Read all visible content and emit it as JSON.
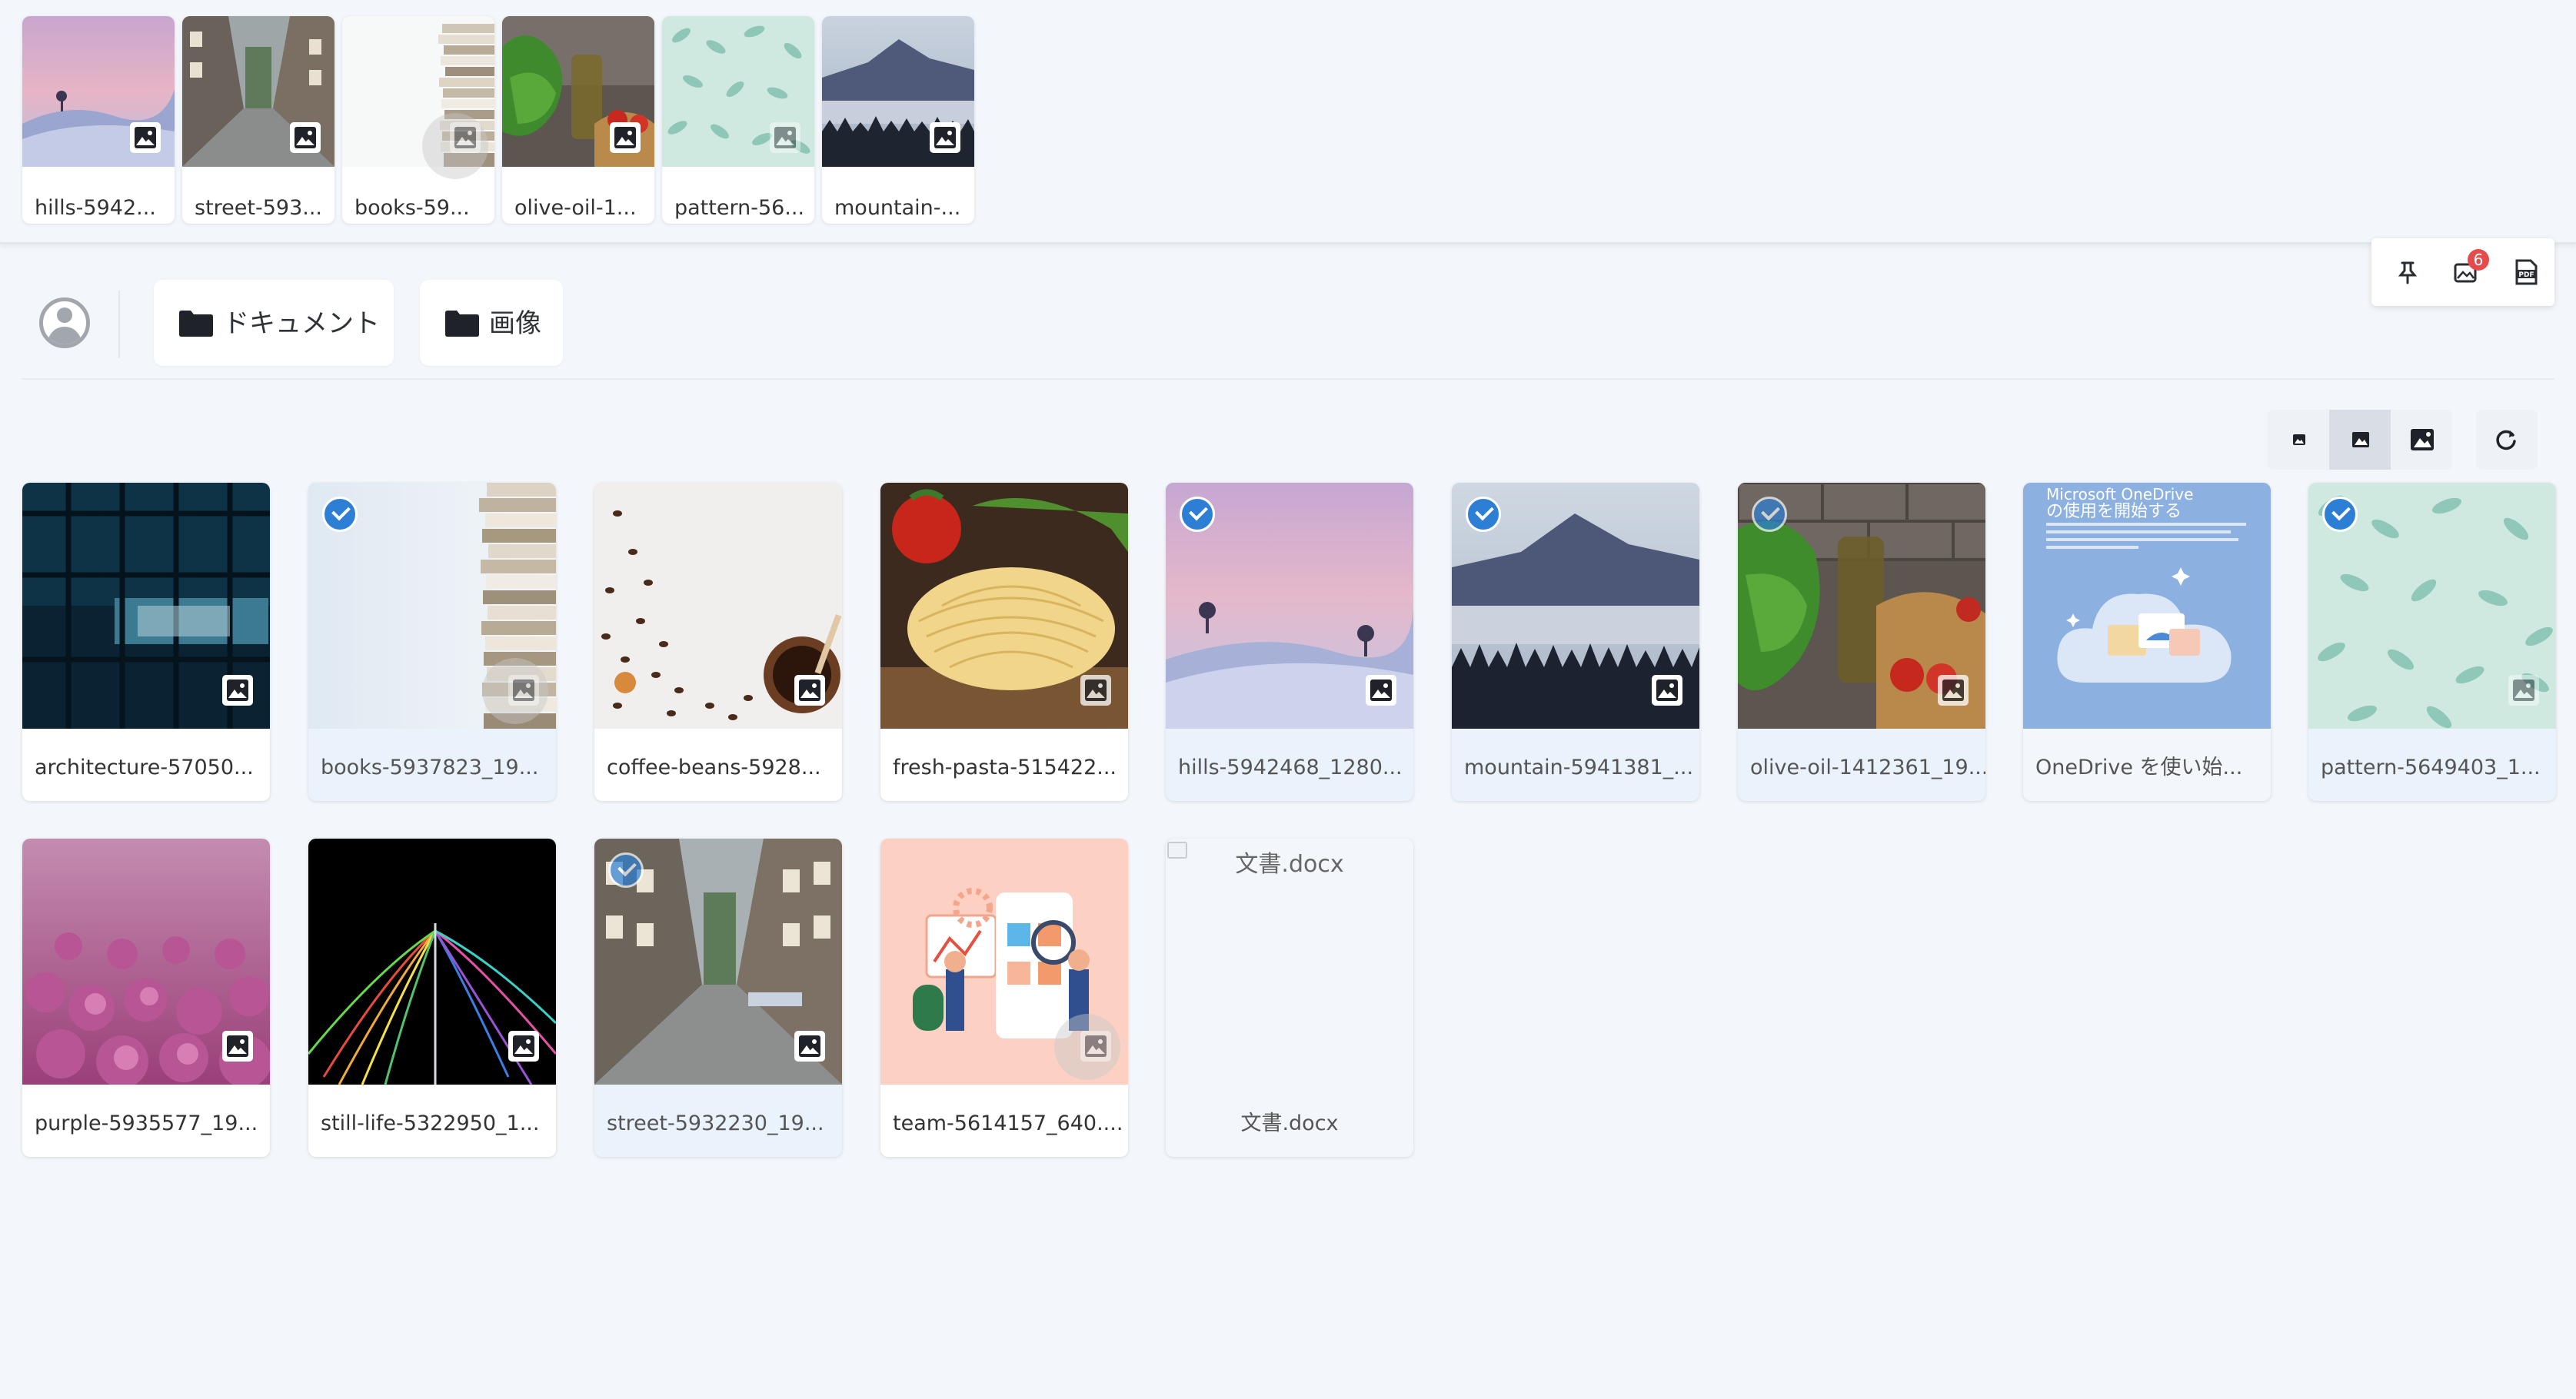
{
  "selected_strip": [
    {
      "name": "hills-5942..."
    },
    {
      "name": "street-593..."
    },
    {
      "name": "books-59..."
    },
    {
      "name": "olive-oil-1..."
    },
    {
      "name": "pattern-56..."
    },
    {
      "name": "mountain-..."
    }
  ],
  "toolbar": {
    "notification_count": "6",
    "icons": [
      "pin-icon",
      "image-stack-icon",
      "pdf-icon"
    ]
  },
  "nav": {
    "folders": [
      {
        "label": "ドキュメント"
      },
      {
        "label": "画像"
      }
    ]
  },
  "view_controls": {
    "sizes": [
      "small",
      "medium",
      "large"
    ],
    "active": "medium"
  },
  "grid": [
    {
      "name": "architecture-57050...",
      "selected": false
    },
    {
      "name": "books-5937823_19...",
      "selected": true
    },
    {
      "name": "coffee-beans-5928...",
      "selected": false
    },
    {
      "name": "fresh-pasta-515422...",
      "selected": false
    },
    {
      "name": "hills-5942468_1280...",
      "selected": true
    },
    {
      "name": "mountain-5941381_...",
      "selected": true
    },
    {
      "name": "olive-oil-1412361_19...",
      "selected": true
    },
    {
      "name": "OneDrive を使い始...",
      "selected": false,
      "thumb_title": "の使用を開始する",
      "thumb_title_top": "Microsoft OneDrive"
    },
    {
      "name": "pattern-5649403_1...",
      "selected": true
    },
    {
      "name": "purple-5935577_19...",
      "selected": false
    },
    {
      "name": "still-life-5322950_1...",
      "selected": false
    },
    {
      "name": "street-5932230_19...",
      "selected": true
    },
    {
      "name": "team-5614157_640....",
      "selected": false
    },
    {
      "name": "文書.docx",
      "selected": false,
      "broken_alt": "文書.docx"
    }
  ],
  "colors": {
    "check_blue": "#2d7fd6",
    "notif_red": "#e54b4b",
    "background": "#f3f6fa"
  }
}
